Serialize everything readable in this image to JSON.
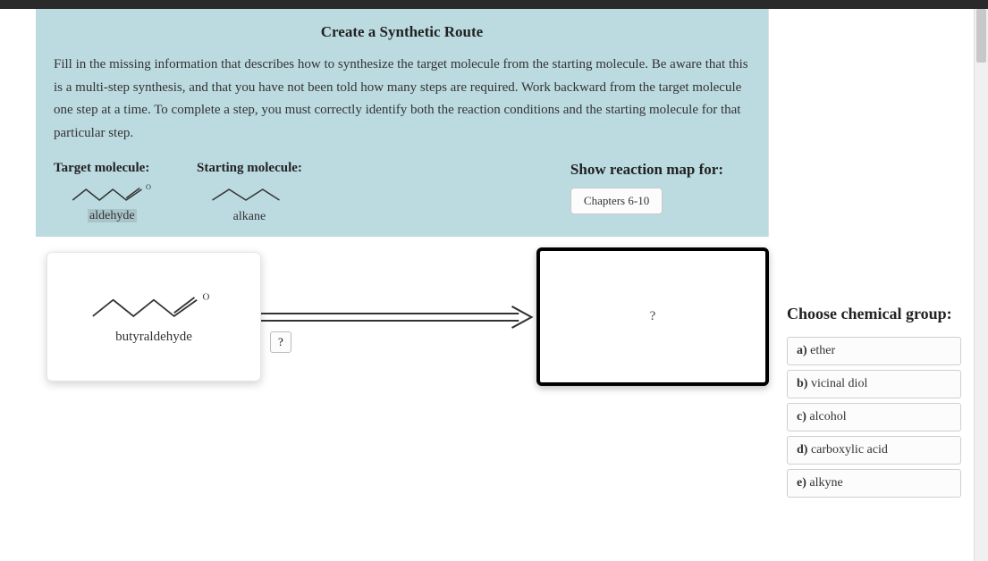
{
  "title": "Create a Synthetic Route",
  "instructions": "Fill in the missing information that describes how to synthesize the target molecule from the starting molecule. Be aware that this is a multi-step synthesis, and that you have not been told how many steps are required. Work backward from the target molecule one step at a time. To complete a step, you must correctly identify both the reaction conditions and the starting molecule for that particular step.",
  "target": {
    "label": "Target molecule:",
    "name": "aldehyde"
  },
  "starting": {
    "label": "Starting molecule:",
    "name": "alkane"
  },
  "reaction_map": {
    "label": "Show reaction map for:",
    "button": "Chapters 6-10"
  },
  "product": {
    "name": "butyraldehyde"
  },
  "conditions_placeholder": "?",
  "reactant_placeholder": "?",
  "choose": {
    "label": "Choose chemical group:",
    "options": [
      {
        "letter": "a)",
        "text": " ether"
      },
      {
        "letter": "b)",
        "text": " vicinal diol"
      },
      {
        "letter": "c)",
        "text": " alcohol"
      },
      {
        "letter": "d)",
        "text": " carboxylic acid"
      },
      {
        "letter": "e)",
        "text": " alkyne"
      }
    ]
  }
}
